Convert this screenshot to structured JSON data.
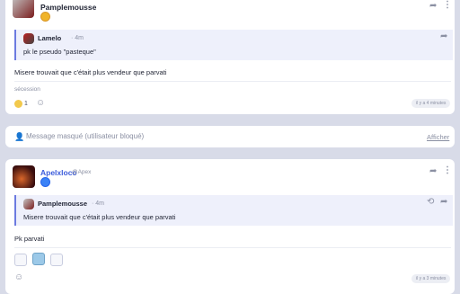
{
  "post1": {
    "author": "Pamplemousse",
    "quote": {
      "author": "Lamelo",
      "time": "· 4m",
      "text": "pk le pseudo \"pasteque\""
    },
    "body": "Misere trouvait que c'était plus vendeur que parvati",
    "tag": "sécession",
    "reaction_count": "1",
    "timestamp": "il y a 4 minutes"
  },
  "masked": {
    "text": "Message masqué (utilisateur bloqué)",
    "show_label": "Afficher"
  },
  "post2": {
    "author": "Apelxloco",
    "handle": "@Apex",
    "quote": {
      "author": "Pamplemousse",
      "time": "· 4m",
      "text": "Misere trouvait que c'était plus vendeur que parvati"
    },
    "body": "Pk parvati",
    "timestamp": "il y a 3 minutes"
  },
  "colors": {
    "accent": "#6c7ae0",
    "link": "#3b5bdb",
    "badge_gold": "#f0b429",
    "badge_blue": "#3b82f6"
  }
}
